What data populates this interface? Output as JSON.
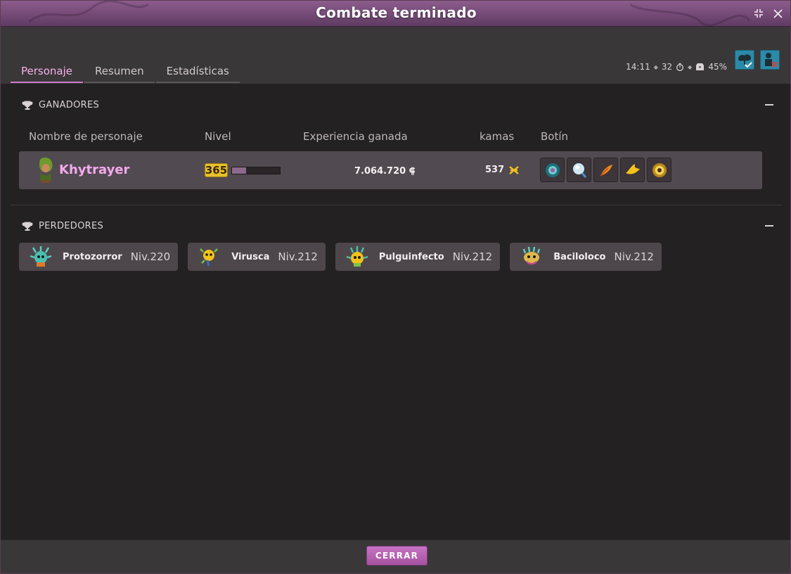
{
  "window": {
    "title": "Combate terminado"
  },
  "tabs": [
    {
      "label": "Personaje",
      "active": true
    },
    {
      "label": "Resumen",
      "active": false
    },
    {
      "label": "Estadísticas",
      "active": false
    }
  ],
  "status": {
    "time": "14:11",
    "turns": "32",
    "percent": "45%"
  },
  "winners": {
    "heading": "GANADORES",
    "columns": {
      "name": "Nombre de personaje",
      "level": "Nivel",
      "xp": "Experiencia ganada",
      "kamas": "kamas",
      "loot": "Botín"
    },
    "row": {
      "name": "Khytrayer",
      "level": "365",
      "level_progress": 0.3,
      "xp": "7.064.720",
      "kamas": "537",
      "loot_icons": [
        "gem-ring-icon",
        "pearl-icon",
        "feather-icon",
        "bird-icon",
        "orb-icon"
      ]
    }
  },
  "losers": {
    "heading": "PERDEDORES",
    "items": [
      {
        "name": "Protozorror",
        "level": "Niv.220"
      },
      {
        "name": "Virusca",
        "level": "Niv.212"
      },
      {
        "name": "Pulguinfecto",
        "level": "Niv.212"
      },
      {
        "name": "Baciloloco",
        "level": "Niv.212"
      }
    ]
  },
  "footer": {
    "close_label": "CERRAR"
  },
  "colors": {
    "accent": "#c77cc4",
    "name_pink": "#f4a9ee",
    "title_bar": "#744a76"
  }
}
